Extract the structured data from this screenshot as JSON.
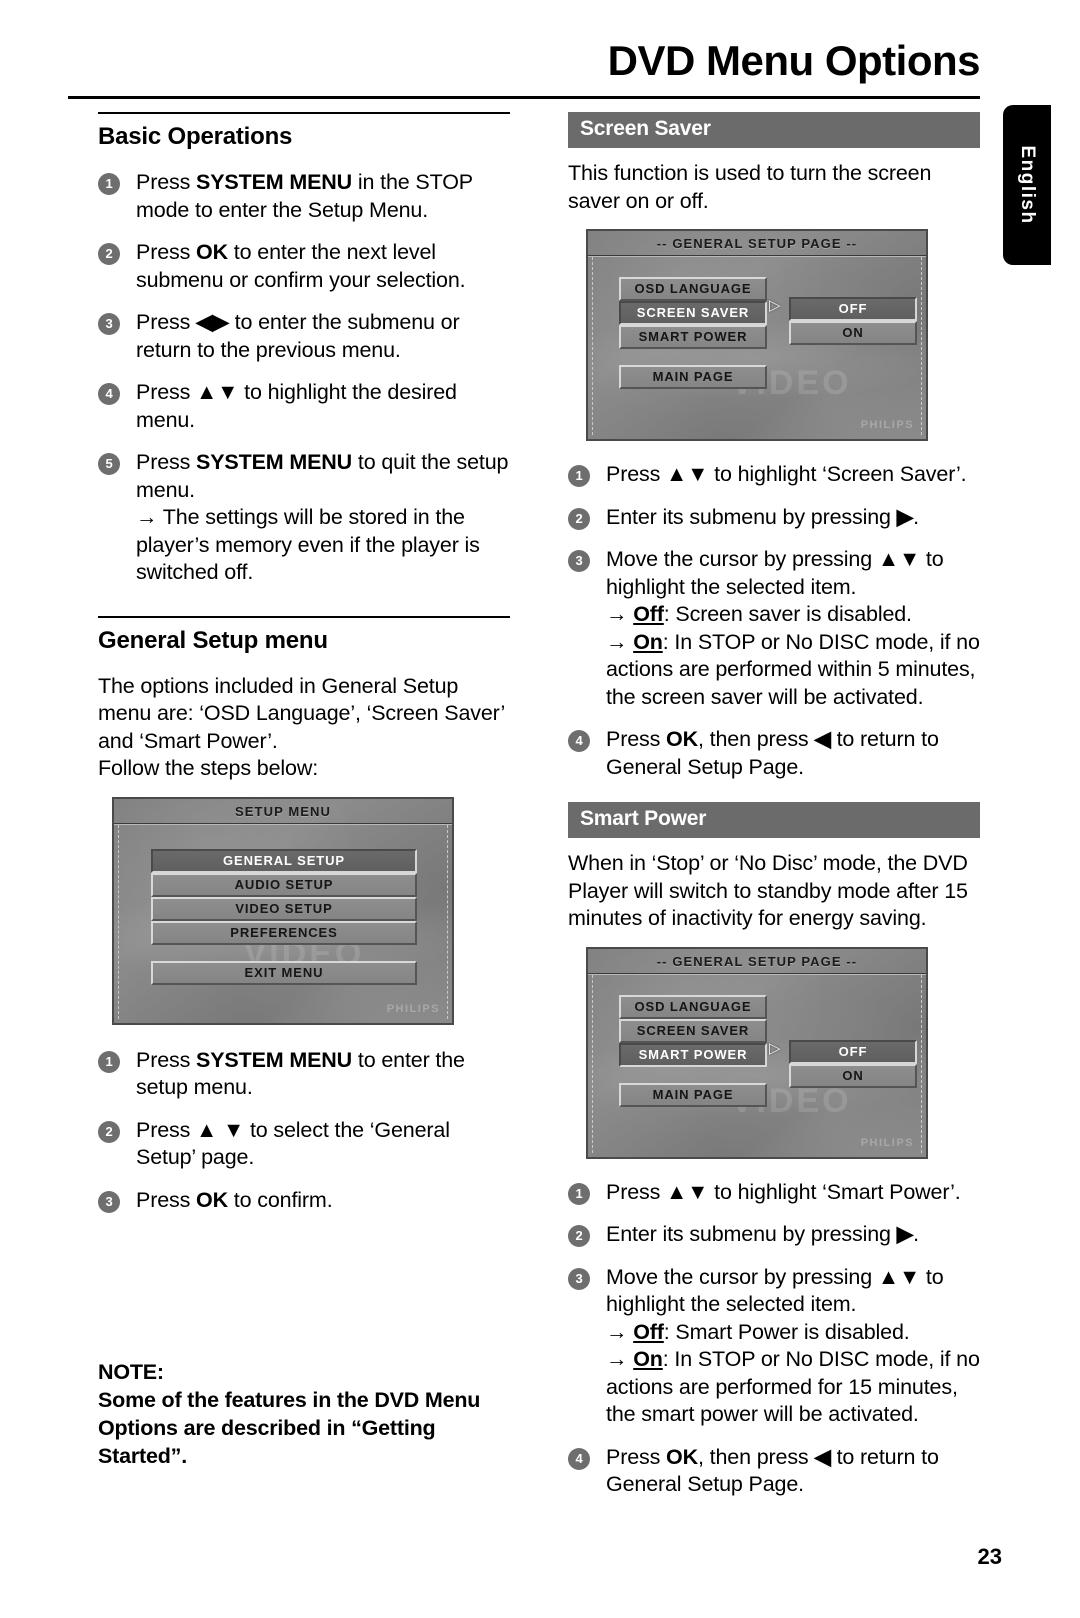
{
  "header": {
    "title": "DVD Menu Options",
    "language_tab": "English"
  },
  "page_number": "23",
  "left_column": {
    "basic_operations": {
      "heading": "Basic Operations",
      "steps": [
        {
          "num": "1",
          "html": "Press <b class=\"k\">SYSTEM MENU</b> in the STOP mode to enter the Setup Menu."
        },
        {
          "num": "2",
          "html": "Press <b class=\"k\">OK</b> to enter the next level submenu or confirm your selection."
        },
        {
          "num": "3",
          "html": "Press <b class=\"k\">◀▶</b> to enter the submenu or return to the previous menu."
        },
        {
          "num": "4",
          "html": "Press <b class=\"k\">▲▼</b> to highlight the desired menu."
        },
        {
          "num": "5",
          "html": "Press <b class=\"k\">SYSTEM MENU</b> to quit the setup menu.<span class=\"sub\"><span class=\"arrow\">→</span> The settings will be stored in the player’s memory even if the player is switched off.</span>"
        }
      ]
    },
    "general_setup": {
      "heading": "General Setup menu",
      "intro_line1": "The options included in General Setup menu are: ‘OSD Language’, ‘Screen Saver’ and ‘Smart Power’.",
      "intro_line2": "Follow the steps below:",
      "steps": [
        {
          "num": "1",
          "html": "Press <b class=\"k\">SYSTEM MENU</b> to enter the setup menu."
        },
        {
          "num": "2",
          "html": "Press <b class=\"k\">▲ ▼</b> to select the ‘General Setup’ page."
        },
        {
          "num": "3",
          "html": "Press <b class=\"k\">OK</b> to confirm."
        }
      ]
    },
    "note": {
      "label": "NOTE:",
      "text": "Some of the features in the DVD Menu Options are described in “Getting Started”."
    },
    "setup_menu_screen": {
      "title": "SETUP MENU",
      "items": [
        {
          "label": "GENERAL SETUP",
          "selected": true
        },
        {
          "label": "AUDIO SETUP",
          "selected": false
        },
        {
          "label": "VIDEO SETUP",
          "selected": false
        },
        {
          "label": "PREFERENCES",
          "selected": false
        }
      ],
      "exit_item": "EXIT MENU",
      "watermark": "VIDEO",
      "brand": "PHILIPS"
    }
  },
  "right_column": {
    "screen_saver": {
      "heading": "Screen Saver",
      "description": "This function is used to turn the screen saver on or off.",
      "screen": {
        "title": "-- GENERAL SETUP PAGE --",
        "menu_items": [
          {
            "label": "OSD LANGUAGE",
            "selected": false
          },
          {
            "label": "SCREEN SAVER",
            "selected": true
          },
          {
            "label": "SMART POWER",
            "selected": false
          }
        ],
        "main_page_item": "MAIN PAGE",
        "options": [
          {
            "label": "OFF",
            "selected": true
          },
          {
            "label": "ON",
            "selected": false
          }
        ],
        "caret": "▷",
        "watermark": "VIDEO",
        "brand": "PHILIPS"
      },
      "steps": [
        {
          "num": "1",
          "html": "Press <b class=\"k\">▲▼</b> to highlight ‘Screen Saver’."
        },
        {
          "num": "2",
          "html": "Enter its submenu by pressing <b class=\"k\">▶</b>."
        },
        {
          "num": "3",
          "html": "Move the cursor by pressing <b class=\"k\">▲▼</b> to highlight the selected item.<span class=\"sub\"><span class=\"arrow\">→</span> <u class=\"k\">Off</u>: Screen saver is disabled.</span><span class=\"sub\"><span class=\"arrow\">→</span> <u class=\"k\">On</u>: In STOP or No DISC mode, if no actions are performed within 5 minutes, the screen saver will be activated.</span>"
        },
        {
          "num": "4",
          "html": "Press <b class=\"k\">OK</b>, then press <b class=\"k\">◀</b> to return to General Setup Page."
        }
      ]
    },
    "smart_power": {
      "heading": "Smart Power",
      "description": "When in ‘Stop’ or ‘No Disc’ mode, the DVD Player will switch to standby mode after 15 minutes of inactivity for energy saving.",
      "screen": {
        "title": "-- GENERAL SETUP PAGE --",
        "menu_items": [
          {
            "label": "OSD LANGUAGE",
            "selected": false
          },
          {
            "label": "SCREEN SAVER",
            "selected": false
          },
          {
            "label": "SMART POWER",
            "selected": true
          }
        ],
        "main_page_item": "MAIN PAGE",
        "options": [
          {
            "label": "OFF",
            "selected": true
          },
          {
            "label": "ON",
            "selected": false
          }
        ],
        "caret": "▷",
        "watermark": "VIDEO",
        "brand": "PHILIPS"
      },
      "steps": [
        {
          "num": "1",
          "html": "Press <b class=\"k\">▲▼</b> to highlight ‘Smart Power’."
        },
        {
          "num": "2",
          "html": "Enter its submenu by pressing <b class=\"k\">▶</b>."
        },
        {
          "num": "3",
          "html": "Move the cursor by pressing <b class=\"k\">▲▼</b> to highlight the selected item.<span class=\"sub\"><span class=\"arrow\">→</span> <u class=\"k\">Off</u>: Smart Power is disabled.</span><span class=\"sub\"><span class=\"arrow\">→</span> <u class=\"k\">On</u>: In STOP or No DISC mode, if no actions are performed for 15 minutes, the smart power will be activated.</span>"
        },
        {
          "num": "4",
          "html": "Press <b class=\"k\">OK</b>, then press <b class=\"k\">◀</b> to return to General Setup Page."
        }
      ]
    }
  }
}
